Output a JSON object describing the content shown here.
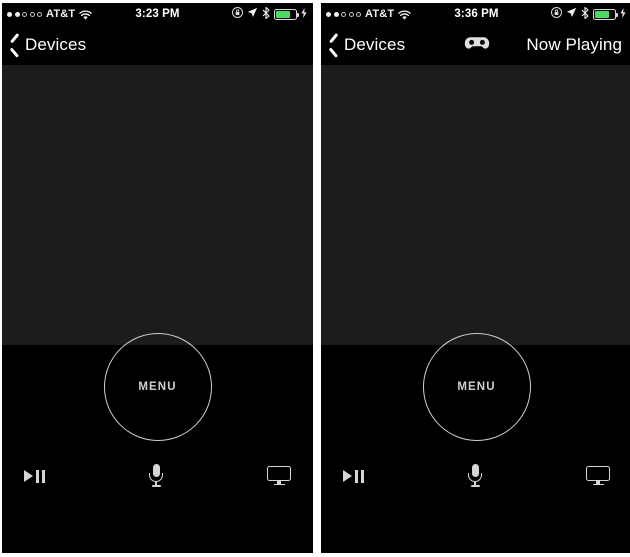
{
  "panels": [
    {
      "id": "left",
      "status": {
        "signal_dots_filled": 2,
        "signal_dots_total": 5,
        "carrier": "AT&T",
        "wifi": "wifi-icon",
        "time": "3:23 PM",
        "rotation_lock": "rotation-lock-icon",
        "location": "location-arrow-icon",
        "bluetooth": "bluetooth-icon",
        "battery_level": "75",
        "battery_color": "#4cd964",
        "charging": "charging-bolt-icon"
      },
      "nav": {
        "back_label": "Devices",
        "back_icon": "chevron-left-icon",
        "center_icon": "",
        "right_label": ""
      },
      "menu": {
        "label": "MENU"
      },
      "toolbar": {
        "play_pause": "play-pause-icon",
        "microphone": "microphone-icon",
        "display": "tv-display-icon"
      }
    },
    {
      "id": "right",
      "status": {
        "signal_dots_filled": 2,
        "signal_dots_total": 5,
        "carrier": "AT&T",
        "wifi": "wifi-icon",
        "time": "3:36 PM",
        "rotation_lock": "rotation-lock-icon",
        "location": "location-arrow-icon",
        "bluetooth": "bluetooth-icon",
        "battery_level": "75",
        "battery_color": "#4cd964",
        "charging": "charging-bolt-icon"
      },
      "nav": {
        "back_label": "Devices",
        "back_icon": "chevron-left-icon",
        "center_icon": "gamepad-icon",
        "right_label": "Now Playing"
      },
      "menu": {
        "label": "MENU"
      },
      "toolbar": {
        "play_pause": "play-pause-icon",
        "microphone": "microphone-icon",
        "display": "tv-display-icon"
      }
    }
  ],
  "colors": {
    "background": "#ffffff",
    "screen_black": "#000000",
    "touchpad_gray": "#1c1c1e",
    "text_primary": "#ffffff",
    "icon_gray": "#d5d5d5",
    "ring_gray": "#cfcfcf",
    "battery_green": "#4cd964"
  }
}
